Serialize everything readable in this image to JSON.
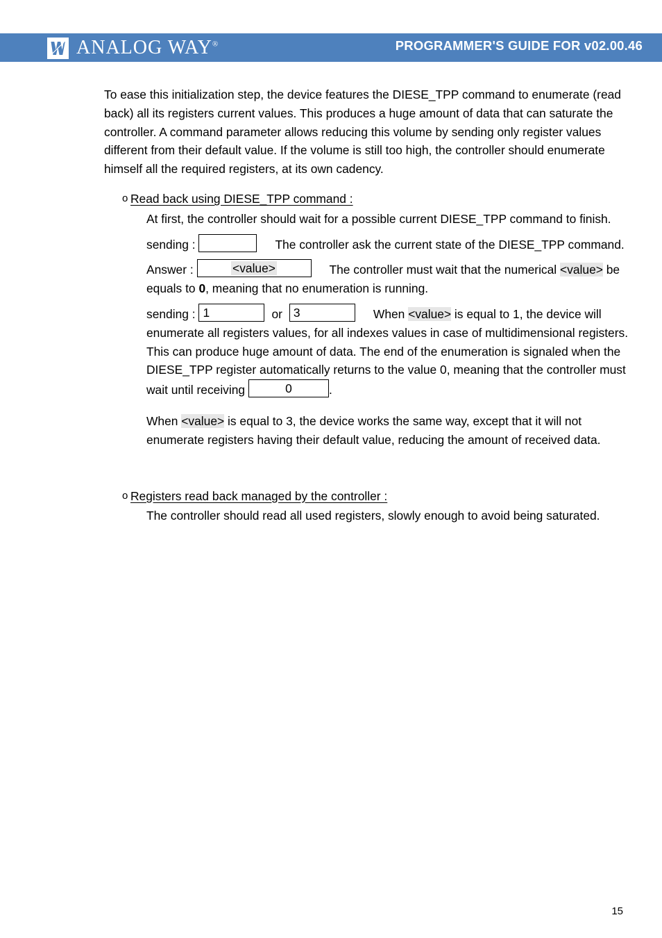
{
  "header": {
    "brand_name": "ANALOG WAY",
    "brand_registered": "®",
    "title": "PROGRAMMER'S GUIDE FOR v02.00.46",
    "band_color": "#4e81bd",
    "text_color": "#ffffff"
  },
  "content": {
    "intro_paragraph": "To ease this initialization step, the device features the DIESE_TPP command to enumerate (read back) all its registers current values. This produces a huge amount of data that can saturate the controller. A command parameter allows reducing this volume by sending only register values different from their default value. If the volume is still too high, the controller should enumerate himself all the required registers, at its own cadency.",
    "bullet_marker": "o",
    "section1": {
      "heading": "Read back using DIESE_TPP command :",
      "para_intro": "At first, the controller should wait for a possible current DIESE_TPP command to finish.",
      "sending_label": "sending :",
      "sending_value_1": "",
      "sending_note_1": "The controller ask the current state of the DIESE_TPP command.",
      "answer_label": "Answer :",
      "answer_value": "<value>",
      "answer_note_prefix": "The controller must wait that the numerical",
      "answer_note_token": "<value>",
      "answer_note_suffix_1": "be equals to",
      "answer_note_bold": "0",
      "answer_note_suffix_2": ", meaning that no enumeration is running.",
      "sending2_label": "sending :",
      "sending2_value_a": "1",
      "sending2_or": "or",
      "sending2_value_b": "3",
      "sending2_note_when": "When",
      "sending2_note_token": "<value>",
      "sending2_note_rest": "is equal to 1, the device will enumerate all registers values, for all indexes values in case of multidimensional registers. This can produce huge amount of data. The end of the enumeration is signaled when the DIESE_TPP register automatically returns to the value 0, meaning that the controller must wait until receiving",
      "receiving_value": "0",
      "receiving_period": ".",
      "para_when3_prefix": "When",
      "para_when3_token": "<value>",
      "para_when3_rest": "is equal to 3, the device works the same way, except that it will not enumerate registers having their default value, reducing the amount of received data."
    },
    "section2": {
      "heading": "Registers read back managed by the controller :",
      "paragraph": "The controller should read all used registers, slowly enough to avoid being saturated."
    }
  },
  "footer": {
    "page_number": "15"
  }
}
